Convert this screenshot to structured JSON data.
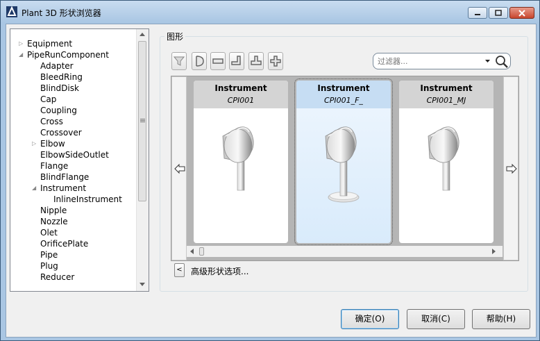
{
  "window": {
    "title": "Plant 3D 形状浏览器"
  },
  "tree": {
    "items": [
      {
        "label": "Equipment",
        "level": 0,
        "arrow": "collapsed"
      },
      {
        "label": "PipeRunComponent",
        "level": 0,
        "arrow": "expanded"
      },
      {
        "label": "Adapter",
        "level": 1,
        "arrow": "none"
      },
      {
        "label": "BleedRing",
        "level": 1,
        "arrow": "none"
      },
      {
        "label": "BlindDisk",
        "level": 1,
        "arrow": "none"
      },
      {
        "label": "Cap",
        "level": 1,
        "arrow": "none"
      },
      {
        "label": "Coupling",
        "level": 1,
        "arrow": "none"
      },
      {
        "label": "Cross",
        "level": 1,
        "arrow": "none"
      },
      {
        "label": "Crossover",
        "level": 1,
        "arrow": "none"
      },
      {
        "label": "Elbow",
        "level": 1,
        "arrow": "collapsed"
      },
      {
        "label": "ElbowSideOutlet",
        "level": 1,
        "arrow": "none"
      },
      {
        "label": "Flange",
        "level": 1,
        "arrow": "none"
      },
      {
        "label": "BlindFlange",
        "level": 1,
        "arrow": "none"
      },
      {
        "label": "Instrument",
        "level": 1,
        "arrow": "expanded"
      },
      {
        "label": "InlineInstrument",
        "level": 2,
        "arrow": "none"
      },
      {
        "label": "Nipple",
        "level": 1,
        "arrow": "none"
      },
      {
        "label": "Nozzle",
        "level": 1,
        "arrow": "none"
      },
      {
        "label": "Olet",
        "level": 1,
        "arrow": "none"
      },
      {
        "label": "OrificePlate",
        "level": 1,
        "arrow": "none"
      },
      {
        "label": "Pipe",
        "level": 1,
        "arrow": "none"
      },
      {
        "label": "Plug",
        "level": 1,
        "arrow": "none"
      },
      {
        "label": "Reducer",
        "level": 1,
        "arrow": "none"
      }
    ]
  },
  "shapes_group": {
    "label": "图形",
    "filter_placeholder": "过滤器..."
  },
  "cards": [
    {
      "name": "Instrument",
      "sub": "CPI001",
      "selected": false
    },
    {
      "name": "Instrument",
      "sub": "CPI001_F_",
      "selected": true
    },
    {
      "name": "Instrument",
      "sub": "CPI001_MJ",
      "selected": false
    }
  ],
  "advanced": {
    "button": "<",
    "label": "高级形状选项..."
  },
  "buttons": {
    "ok": "确定(O)",
    "cancel": "取消(C)",
    "help": "帮助(H)"
  }
}
